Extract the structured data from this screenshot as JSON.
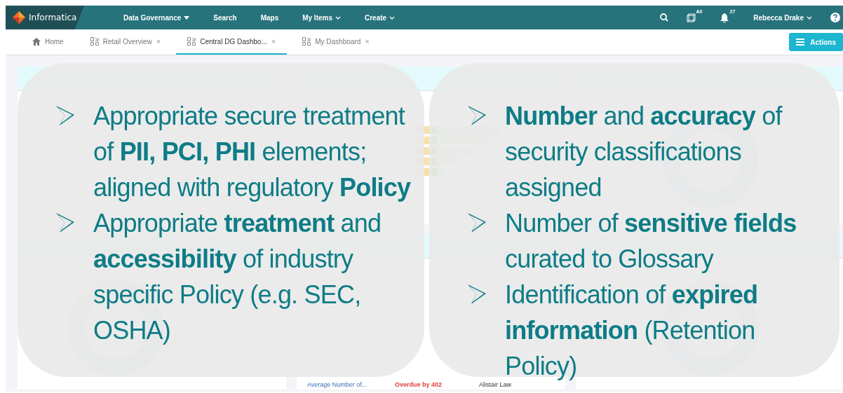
{
  "nav": {
    "logo": "Informatica",
    "items": [
      {
        "label": "Data Governance",
        "kind": "solid"
      },
      {
        "label": "Search",
        "kind": "plain"
      },
      {
        "label": "Maps",
        "kind": "plain"
      },
      {
        "label": "My Items",
        "kind": "chevron"
      },
      {
        "label": "Create",
        "kind": "chevron"
      }
    ],
    "scope_badge": "All",
    "alerts_badge": "27",
    "user": "Rebecca Drake"
  },
  "tabs": [
    {
      "label": "Home",
      "kind": "home",
      "selected": false
    },
    {
      "label": "Retail Overview",
      "kind": "dashboard",
      "selected": false,
      "close": "×"
    },
    {
      "label": "Central DG Dashbo...",
      "kind": "dashboard",
      "selected": true,
      "close": "×"
    },
    {
      "label": "My Dashboard",
      "kind": "dashboard",
      "selected": false,
      "close": "×"
    }
  ],
  "actions_button": "Actions",
  "tasks_card": {
    "rows": [
      {
        "object": "Average Number of...",
        "due": "Overdue by 402",
        "owner": "Alistair Law"
      }
    ]
  },
  "callouts": [
    {
      "bullets": [
        "Appropriate secure treatment of **PII, PCI, PHI** elements; aligned with regulatory **Policy**",
        "Appropriate **treatment** and **accessibility** of industry specific Policy (e.g. SEC, OSHA)"
      ]
    },
    {
      "bullets": [
        "**Number** and **accuracy** of security classifications assigned",
        "Number of **sensitive fields** curated to Glossary",
        "Identification of **expired information** (Retention Policy)"
      ]
    }
  ]
}
